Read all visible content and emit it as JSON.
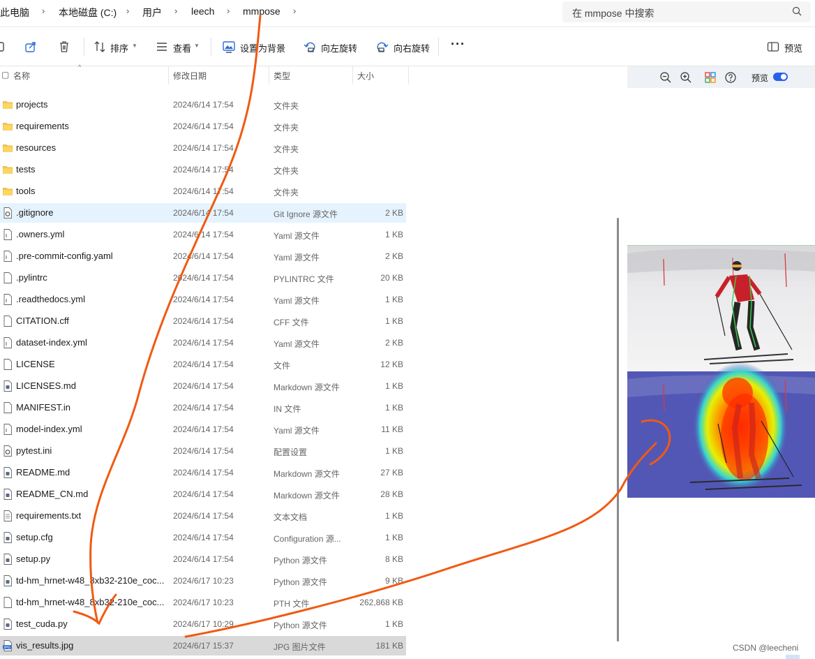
{
  "address_bar": {
    "crumbs": [
      "此电脑",
      "本地磁盘 (C:)",
      "用户",
      "leech",
      "mmpose"
    ]
  },
  "search": {
    "placeholder": "在 mmpose 中搜索"
  },
  "toolbar": {
    "sort_label": "排序",
    "view_label": "查看",
    "set_background_label": "设置为背景",
    "rotate_left_label": "向左旋转",
    "rotate_right_label": "向右旋转",
    "more_label": "···",
    "preview_label": "预览"
  },
  "list_header": {
    "name": "名称",
    "date": "修改日期",
    "type": "类型",
    "size": "大小"
  },
  "files": [
    {
      "name": "projects",
      "date": "2024/6/14 17:54",
      "type": "文件夹",
      "size": "",
      "icon": "folder"
    },
    {
      "name": "requirements",
      "date": "2024/6/14 17:54",
      "type": "文件夹",
      "size": "",
      "icon": "folder"
    },
    {
      "name": "resources",
      "date": "2024/6/14 17:54",
      "type": "文件夹",
      "size": "",
      "icon": "folder"
    },
    {
      "name": "tests",
      "date": "2024/6/14 17:54",
      "type": "文件夹",
      "size": "",
      "icon": "folder"
    },
    {
      "name": "tools",
      "date": "2024/6/14 17:54",
      "type": "文件夹",
      "size": "",
      "icon": "folder"
    },
    {
      "name": ".gitignore",
      "date": "2024/6/14 17:54",
      "type": "Git Ignore 源文件",
      "size": "2 KB",
      "icon": "gear-file"
    },
    {
      "name": ".owners.yml",
      "date": "2024/6/14 17:54",
      "type": "Yaml 源文件",
      "size": "1 KB",
      "icon": "text-file"
    },
    {
      "name": ".pre-commit-config.yaml",
      "date": "2024/6/14 17:54",
      "type": "Yaml 源文件",
      "size": "2 KB",
      "icon": "text-file"
    },
    {
      "name": ".pylintrc",
      "date": "2024/6/14 17:54",
      "type": "PYLINTRC 文件",
      "size": "20 KB",
      "icon": "blank-file"
    },
    {
      "name": ".readthedocs.yml",
      "date": "2024/6/14 17:54",
      "type": "Yaml 源文件",
      "size": "1 KB",
      "icon": "text-file"
    },
    {
      "name": "CITATION.cff",
      "date": "2024/6/14 17:54",
      "type": "CFF 文件",
      "size": "1 KB",
      "icon": "blank-file"
    },
    {
      "name": "dataset-index.yml",
      "date": "2024/6/14 17:54",
      "type": "Yaml 源文件",
      "size": "2 KB",
      "icon": "text-file"
    },
    {
      "name": "LICENSE",
      "date": "2024/6/14 17:54",
      "type": "文件",
      "size": "12 KB",
      "icon": "blank-file"
    },
    {
      "name": "LICENSES.md",
      "date": "2024/6/14 17:54",
      "type": "Markdown 源文件",
      "size": "1 KB",
      "icon": "md-file"
    },
    {
      "name": "MANIFEST.in",
      "date": "2024/6/14 17:54",
      "type": "IN 文件",
      "size": "1 KB",
      "icon": "blank-file"
    },
    {
      "name": "model-index.yml",
      "date": "2024/6/14 17:54",
      "type": "Yaml 源文件",
      "size": "11 KB",
      "icon": "text-file"
    },
    {
      "name": "pytest.ini",
      "date": "2024/6/14 17:54",
      "type": "配置设置",
      "size": "1 KB",
      "icon": "gear-file"
    },
    {
      "name": "README.md",
      "date": "2024/6/14 17:54",
      "type": "Markdown 源文件",
      "size": "27 KB",
      "icon": "md-file"
    },
    {
      "name": "README_CN.md",
      "date": "2024/6/14 17:54",
      "type": "Markdown 源文件",
      "size": "28 KB",
      "icon": "md-file"
    },
    {
      "name": "requirements.txt",
      "date": "2024/6/14 17:54",
      "type": "文本文档",
      "size": "1 KB",
      "icon": "lines-file"
    },
    {
      "name": "setup.cfg",
      "date": "2024/6/14 17:54",
      "type": "Configuration 源...",
      "size": "1 KB",
      "icon": "md-file"
    },
    {
      "name": "setup.py",
      "date": "2024/6/14 17:54",
      "type": "Python 源文件",
      "size": "8 KB",
      "icon": "md-file"
    },
    {
      "name": "td-hm_hrnet-w48_8xb32-210e_coc...",
      "date": "2024/6/17 10:23",
      "type": "Python 源文件",
      "size": "9 KB",
      "icon": "md-file"
    },
    {
      "name": "td-hm_hrnet-w48_8xb32-210e_coc...",
      "date": "2024/6/17 10:23",
      "type": "PTH 文件",
      "size": "262,868 KB",
      "icon": "blank-file"
    },
    {
      "name": "test_cuda.py",
      "date": "2024/6/17 10:29",
      "type": "Python 源文件",
      "size": "1 KB",
      "icon": "md-file"
    },
    {
      "name": "vis_results.jpg",
      "date": "2024/6/17 15:37",
      "type": "JPG 图片文件",
      "size": "181 KB",
      "icon": "jpg-file"
    }
  ],
  "hovered_index": 5,
  "selected_index": 25,
  "preview_pane": {
    "toggle_label": "预览",
    "toggle_on": true
  },
  "watermark": "CSDN @leecheni",
  "colors": {
    "annotation": "#f05a12",
    "accent": "#2563eb",
    "hover": "#e5f3ff",
    "selected": "#d9d9d9"
  }
}
